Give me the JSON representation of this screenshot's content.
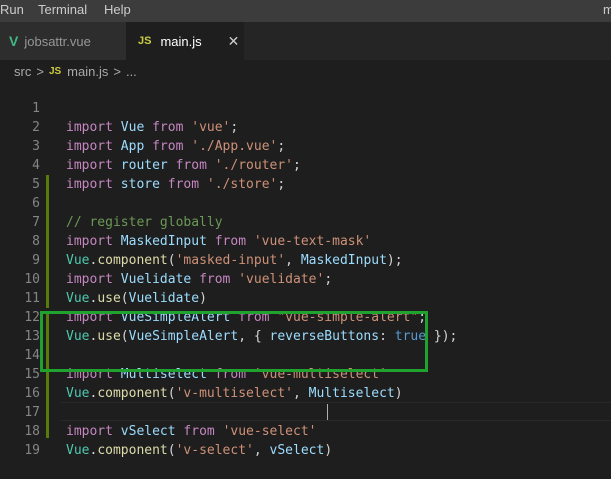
{
  "menubar": {
    "items": [
      "Run",
      "Terminal",
      "Help"
    ],
    "right_text": "m"
  },
  "tabs": [
    {
      "icon": "vue-logo-icon",
      "label": "jobsattr.vue",
      "active": false
    },
    {
      "icon": "js-file-icon",
      "label": "main.js",
      "active": true,
      "close": "✕"
    }
  ],
  "breadcrumb": {
    "folder": "src",
    "sep1": ">",
    "file_icon": "JS",
    "file": "main.js",
    "sep2": ">",
    "trail": "..."
  },
  "editor": {
    "line_numbers": [
      "1",
      "2",
      "3",
      "4",
      "5",
      "6",
      "7",
      "8",
      "9",
      "10",
      "11",
      "12",
      "13",
      "14",
      "15",
      "16",
      "17",
      "18",
      "19"
    ],
    "l1": {
      "k": "import",
      "a": "Vue",
      "f": "from",
      "s": "'vue'",
      "e": ";"
    },
    "l2": {
      "k": "import",
      "a": "App",
      "f": "from",
      "s": "'./App.vue'",
      "e": ";"
    },
    "l3": {
      "k": "import",
      "a": "router",
      "f": "from",
      "s": "'./router'",
      "e": ";"
    },
    "l4": {
      "k": "import",
      "a": "store",
      "f": "from",
      "s": "'./store'",
      "e": ";"
    },
    "l6": {
      "c": "// register globally"
    },
    "l7": {
      "k": "import",
      "a": "MaskedInput",
      "f": "from",
      "s": "'vue-text-mask'"
    },
    "l8": {
      "o": "Vue",
      "d": ".",
      "m": "component",
      "p1": "(",
      "s": "'masked-input'",
      "cm": ", ",
      "a": "MaskedInput",
      "p2": ");"
    },
    "l9": {
      "k": "import",
      "a": "Vuelidate",
      "f": "from",
      "s": "'vuelidate'",
      "e": ";"
    },
    "l10": {
      "o": "Vue",
      "d": ".",
      "m": "use",
      "p1": "(",
      "a": "Vuelidate",
      "p2": ")"
    },
    "l11": {
      "k": "import",
      "a": "VueSimpleAlert",
      "f": "from",
      "s": "\"vue-simple-alert\"",
      "e": ";"
    },
    "l12": {
      "o": "Vue",
      "d": ".",
      "m": "use",
      "p1": "(",
      "a": "VueSimpleAlert",
      "b1": ", { ",
      "prop": "reverseButtons",
      "col": ": ",
      "val": "true",
      "b2": " });"
    },
    "l14": {
      "k": "import",
      "a": "Multiselect",
      "f": "from",
      "s": "'vue-multiselect'"
    },
    "l15": {
      "o": "Vue",
      "d": ".",
      "m": "component",
      "p1": "(",
      "s": "'v-multiselect'",
      "cm": ", ",
      "a": "Multiselect",
      "p2": ")"
    },
    "l17": {
      "k": "import",
      "a": "vSelect",
      "f": "from",
      "s": "'vue-select'"
    },
    "l18": {
      "o": "Vue",
      "d": ".",
      "m": "component",
      "p1": "(",
      "s": "'v-select'",
      "cm": ", ",
      "a": "vSelect",
      "p2": ")"
    }
  },
  "colors": {
    "highlight_box": "#1fa22e",
    "keyword": "#c586c0",
    "string": "#ce9178",
    "variable": "#9cdcfe",
    "class": "#4ec9b0",
    "function": "#dcdcaa",
    "comment": "#6a9955"
  }
}
